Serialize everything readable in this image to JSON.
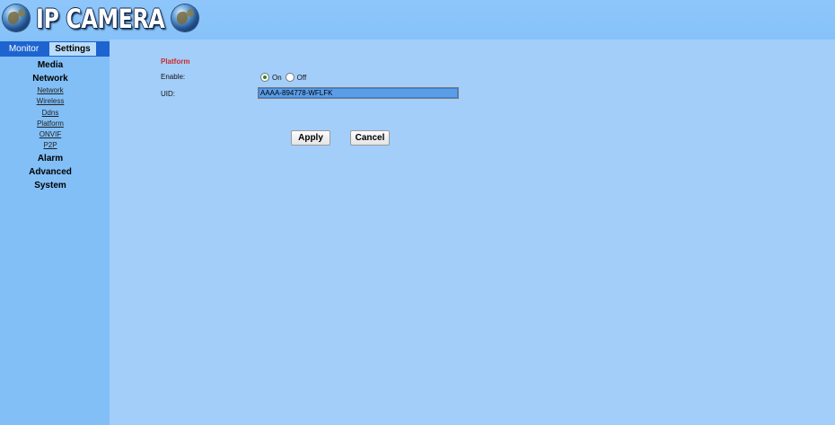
{
  "header": {
    "logo_text": "IP CAMERA"
  },
  "tabs": {
    "monitor": "Monitor",
    "settings": "Settings"
  },
  "sidebar": {
    "sections": [
      {
        "label": "Media"
      },
      {
        "label": "Network",
        "items": [
          "Network",
          "Wireless",
          "Ddns",
          "Platform",
          "ONVIF",
          "P2P"
        ]
      },
      {
        "label": "Alarm"
      },
      {
        "label": "Advanced"
      },
      {
        "label": "System"
      }
    ]
  },
  "form": {
    "title": "Platform",
    "enable_label": "Enable:",
    "enable_options": [
      "On",
      "Off"
    ],
    "enable_selected": "On",
    "uid_label": "UID:",
    "uid_value": "AAAA-894778-WFLFK"
  },
  "buttons": {
    "apply": "Apply",
    "cancel": "Cancel"
  },
  "colors": {
    "page_background": "#a3cefa",
    "header_background": "#8ec6fb",
    "sidebar_background": "#82bff7",
    "tab_bar": "#1d64d0",
    "section_title": "#cc2a2a"
  }
}
